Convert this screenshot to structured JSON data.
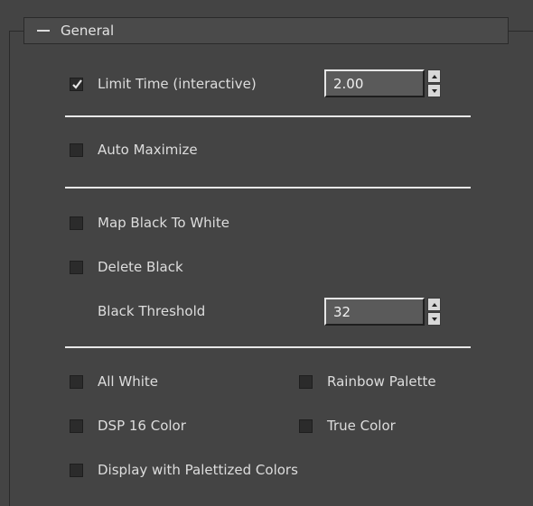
{
  "rollout": {
    "title": "General",
    "expanded": true
  },
  "limit_time": {
    "label": "Limit Time (interactive)",
    "checked": true,
    "value": "2.00"
  },
  "auto_maximize": {
    "label": "Auto Maximize",
    "checked": false
  },
  "map_black_to_white": {
    "label": "Map Black To White",
    "checked": false
  },
  "delete_black": {
    "label": "Delete Black",
    "checked": false
  },
  "black_threshold": {
    "label": "Black Threshold",
    "value": "32"
  },
  "all_white": {
    "label": "All White",
    "checked": false
  },
  "rainbow_palette": {
    "label": "Rainbow Palette",
    "checked": false
  },
  "dsp_16_color": {
    "label": "DSP 16 Color",
    "checked": false
  },
  "true_color": {
    "label": "True Color",
    "checked": false
  },
  "display_palettized": {
    "label": "Display with Palettized Colors",
    "checked": false
  },
  "colors": {
    "panel_bg": "#444444",
    "field_bg": "#5a5a5a",
    "text": "#dddddd",
    "separator": "#e8e8e8"
  }
}
